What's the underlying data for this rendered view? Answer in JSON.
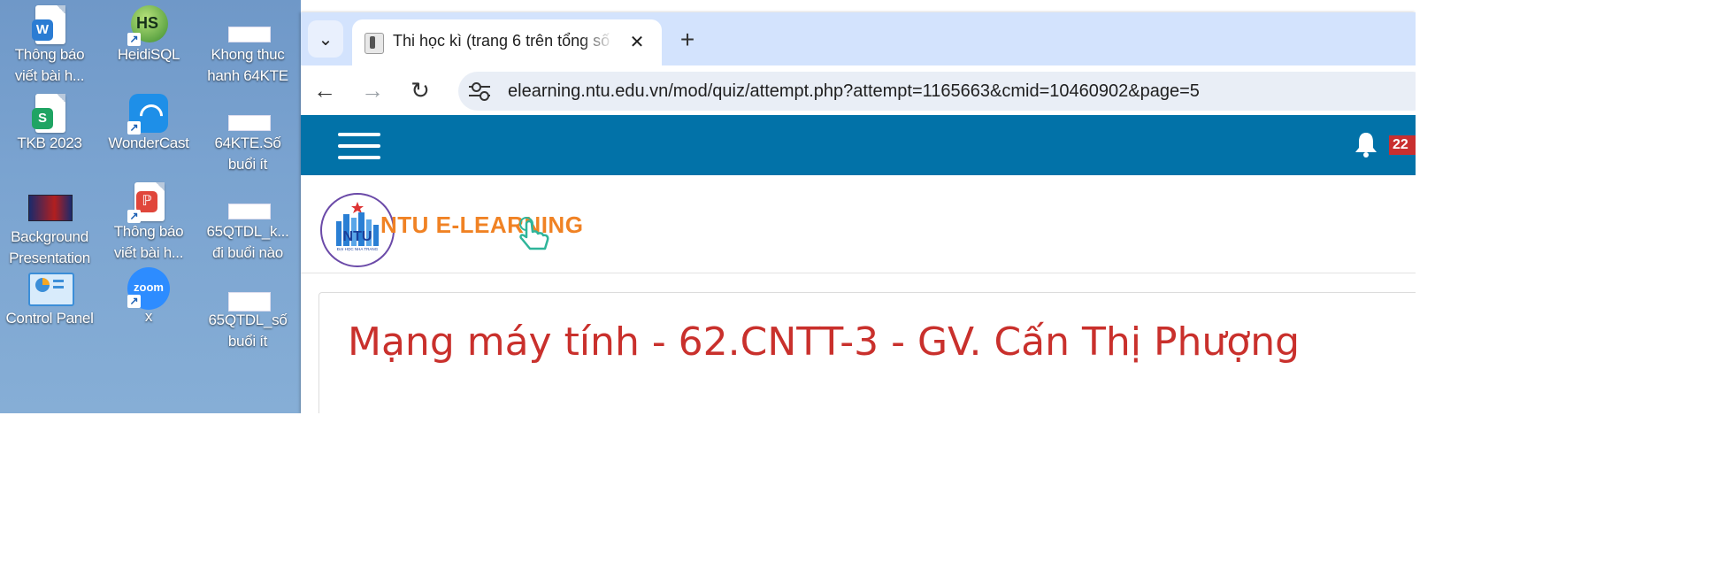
{
  "desktop": {
    "icons": [
      {
        "label1": "Thông báo",
        "label2": "viết bài h..."
      },
      {
        "label1": "HeidiSQL",
        "label2": ""
      },
      {
        "label1": "Khong thuc",
        "label2": "hanh 64KTE"
      },
      {
        "label1": "TKB 2023",
        "label2": ""
      },
      {
        "label1": "WonderCast",
        "label2": ""
      },
      {
        "label1": "64KTE.Số",
        "label2": "buổi ít"
      },
      {
        "label1": "Background",
        "label2": "Presentation"
      },
      {
        "label1": "Thông báo",
        "label2": "viết bài h..."
      },
      {
        "label1": "65QTDL_k...",
        "label2": "đi buổi nào"
      },
      {
        "label1": "Control Panel",
        "label2": ""
      },
      {
        "label1": "x",
        "label2": ""
      },
      {
        "label1": "65QTDL_số",
        "label2": "buổi ít"
      }
    ],
    "badges": {
      "word": "W",
      "heidi": "HS",
      "wps": "S",
      "zoom": "zoom"
    }
  },
  "browser": {
    "tab_title": "Thi học kì (trang 6 trên tổng số",
    "tab_close": "✕",
    "new_tab": "+",
    "tab_search": "⌄",
    "back": "←",
    "forward": "→",
    "reload": "↻",
    "url": "elearning.ntu.edu.vn/mod/quiz/attempt.php?attempt=1165663&cmid=10460902&page=5"
  },
  "site": {
    "notification_count": "22",
    "brand_name": "NTU E-LEARNING",
    "logo_text": "NTU",
    "logo_subtext": "ĐẠI HỌC NHA TRANG",
    "course_title": "Mạng máy tính - 62.CNTT-3 - GV. Cấn Thị Phượng"
  },
  "colors": {
    "navbar": "#0272a8",
    "brand_orange": "#f08224",
    "title_red": "#c9302c",
    "notif_red": "#c92f2f"
  }
}
